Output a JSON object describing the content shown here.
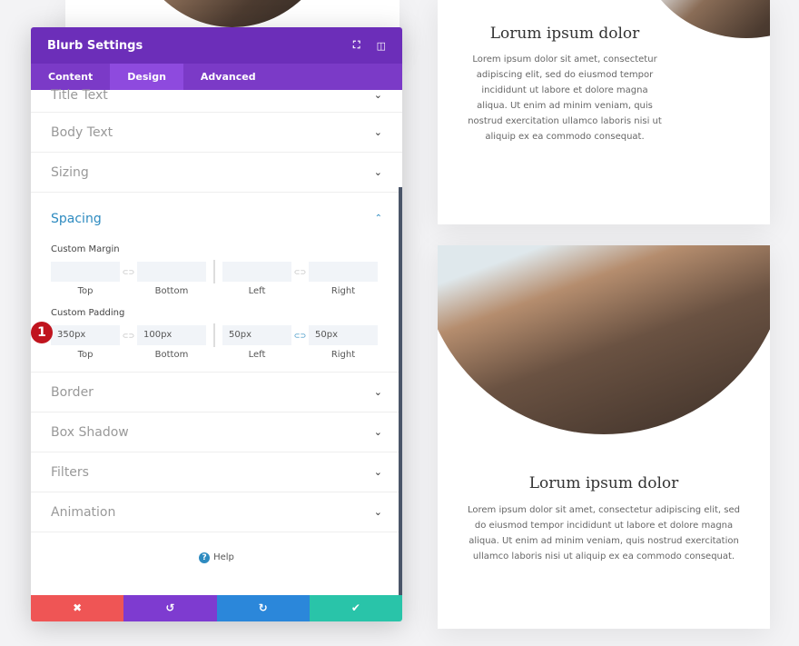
{
  "panel": {
    "title": "Blurb Settings",
    "tabs": [
      "Content",
      "Design",
      "Advanced"
    ],
    "sections_before": [
      "Title Text",
      "Body Text",
      "Sizing"
    ],
    "spacing": {
      "title": "Spacing",
      "margin_label": "Custom Margin",
      "padding_label": "Custom Padding",
      "captions": [
        "Top",
        "Bottom",
        "Left",
        "Right"
      ],
      "margin_values": [
        "",
        "",
        "",
        ""
      ],
      "padding_values": [
        "350px",
        "100px",
        "50px",
        "50px"
      ]
    },
    "sections_after": [
      "Border",
      "Box Shadow",
      "Filters",
      "Animation"
    ],
    "help": "Help",
    "badge": "1",
    "footer_colors": {
      "cancel": "#ef5555",
      "undo": "#7e3bd0",
      "redo": "#2b87da",
      "save": "#29c4a9"
    }
  },
  "cards": [
    {
      "title": "Lorum ipsum dolor",
      "body": "Lorem ipsum dolor sit amet, consectetur adipiscing elit, sed do eiusmod tempor incididunt ut labore et dolore magna aliqua. Ut enim ad minim veniam, quis nostrud exercitation ullamco laboris nisi ut aliquip ex ea commodo consequat."
    },
    {
      "title": "Lorum ipsum dolor",
      "body": "Lorem ipsum dolor sit amet, consectetur adipiscing elit, sed do eiusmod tempor incididunt ut labore et dolore magna aliqua. Ut enim ad minim veniam, quis nostrud exercitation ullamco laboris nisi ut aliquip ex ea commodo consequat."
    }
  ]
}
